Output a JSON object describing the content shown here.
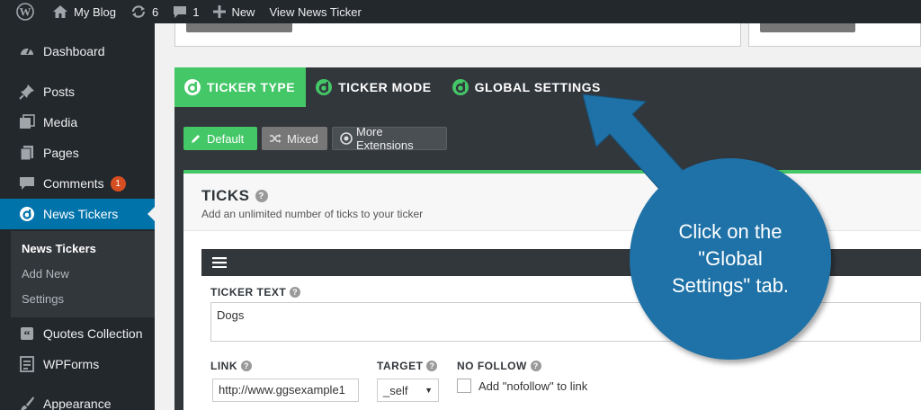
{
  "adminbar": {
    "site_name": "My Blog",
    "updates_count": "6",
    "comments_count": "1",
    "new_label": "New",
    "view_label": "View News Ticker"
  },
  "sidebar": {
    "items": [
      {
        "label": "Dashboard",
        "icon": "dashboard-icon"
      },
      {
        "label": "Posts",
        "icon": "pin-icon"
      },
      {
        "label": "Media",
        "icon": "media-icon"
      },
      {
        "label": "Pages",
        "icon": "pages-icon"
      },
      {
        "label": "Comments",
        "icon": "comment-icon",
        "badge": "1"
      },
      {
        "label": "News Tickers",
        "icon": "ticker-logo-icon"
      },
      {
        "label": "Quotes Collection",
        "icon": "quote-icon"
      },
      {
        "label": "WPForms",
        "icon": "forms-icon"
      },
      {
        "label": "Appearance",
        "icon": "brush-icon"
      }
    ],
    "submenu": [
      "News Tickers",
      "Add New",
      "Settings"
    ]
  },
  "tabs": [
    "TICKER TYPE",
    "TICKER MODE",
    "GLOBAL SETTINGS"
  ],
  "modes": [
    "Default",
    "Mixed",
    "More Extensions"
  ],
  "ticks": {
    "title": "TICKS",
    "subtitle": "Add an unlimited number of ticks to your ticker"
  },
  "fields": {
    "ticker_text_label": "TICKER TEXT",
    "ticker_text_value": "Dogs",
    "link_label": "LINK",
    "link_value": "http://www.ggsexample1",
    "target_label": "TARGET",
    "target_value": "_self",
    "nofollow_label": "NO FOLLOW",
    "nofollow_text": "Add \"nofollow\" to link"
  },
  "callout": {
    "text": "Click on the \"Global Settings\" tab."
  },
  "colors": {
    "accent_green": "#44c767",
    "wp_blue": "#0073aa",
    "callout_blue": "#1f72a7",
    "dark": "#23282d"
  }
}
